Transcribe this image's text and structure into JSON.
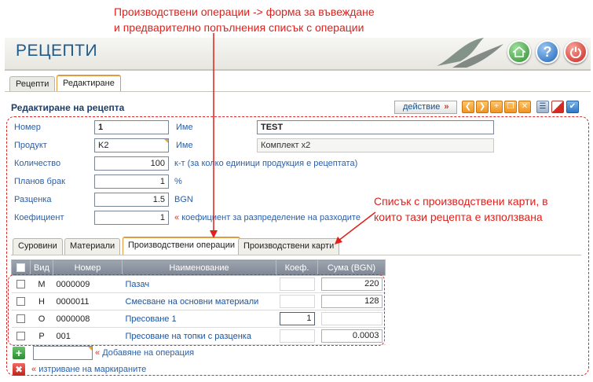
{
  "annotations": {
    "top_line1": "Производствени операции -> форма за въвеждане",
    "top_line2": "и предварително попълнения списък с операции",
    "right_line1": "Списък с  производствени карти, в",
    "right_line2": "които тази рецепта е използвана"
  },
  "app": {
    "title": "РЕЦЕПТИ"
  },
  "header_buttons": {
    "help_glyph": "?"
  },
  "tabs": [
    "Рецепти",
    "Редактиране"
  ],
  "section": {
    "title": "Редактиране на рецепта"
  },
  "toolbar": {
    "action_label": "действие",
    "action_arrow": "»"
  },
  "form": {
    "number_label": "Номер",
    "number_value": "1",
    "name_label": "Име",
    "name_value": "TEST",
    "product_label": "Продукт",
    "product_value": "K2",
    "product_name_label": "Име",
    "product_name_value": "Комплект x2",
    "qty_label": "Количество",
    "qty_value": "100",
    "qty_note": "к-т (за колко единици продукция е рецептата)",
    "waste_label": "Планов брак",
    "waste_value": "1",
    "waste_unit": "%",
    "cost_label": "Разценка",
    "cost_value": "1.5",
    "cost_unit": "BGN",
    "coef_label": "Коефициент",
    "coef_value": "1",
    "coef_note_mark": "«",
    "coef_note": "коефициент за разпределение на разходите"
  },
  "sub_tabs": [
    "Суровини",
    "Материали",
    "Производствени операции",
    "Производствени карти"
  ],
  "table": {
    "headers": [
      "Вид",
      "Номер",
      "Наименование",
      "Коеф.",
      "Сума (BGN)"
    ],
    "rows": [
      {
        "kind": "M",
        "number": "0000009",
        "name": "Пазач",
        "coef": "",
        "sum": "220"
      },
      {
        "kind": "H",
        "number": "0000011",
        "name": "Смесване на основни материали",
        "coef": "",
        "sum": "128"
      },
      {
        "kind": "O",
        "number": "0000008",
        "name": "Пресоване 1",
        "coef": "1",
        "sum": ""
      },
      {
        "kind": "P",
        "number": "001",
        "name": "Пресоване на топки с разценка",
        "coef": "",
        "sum": "0.0003"
      }
    ]
  },
  "footer": {
    "add_mark": "«",
    "add_label": "Добавяне на операция",
    "delete_mark": "«",
    "delete_label": "изтриване на маркираните"
  },
  "colors": {
    "accent": "#e0201a",
    "brand_blue": "#1c5b8c",
    "label_blue": "#2a5fa8",
    "tab_orange": "#e39a3f"
  }
}
